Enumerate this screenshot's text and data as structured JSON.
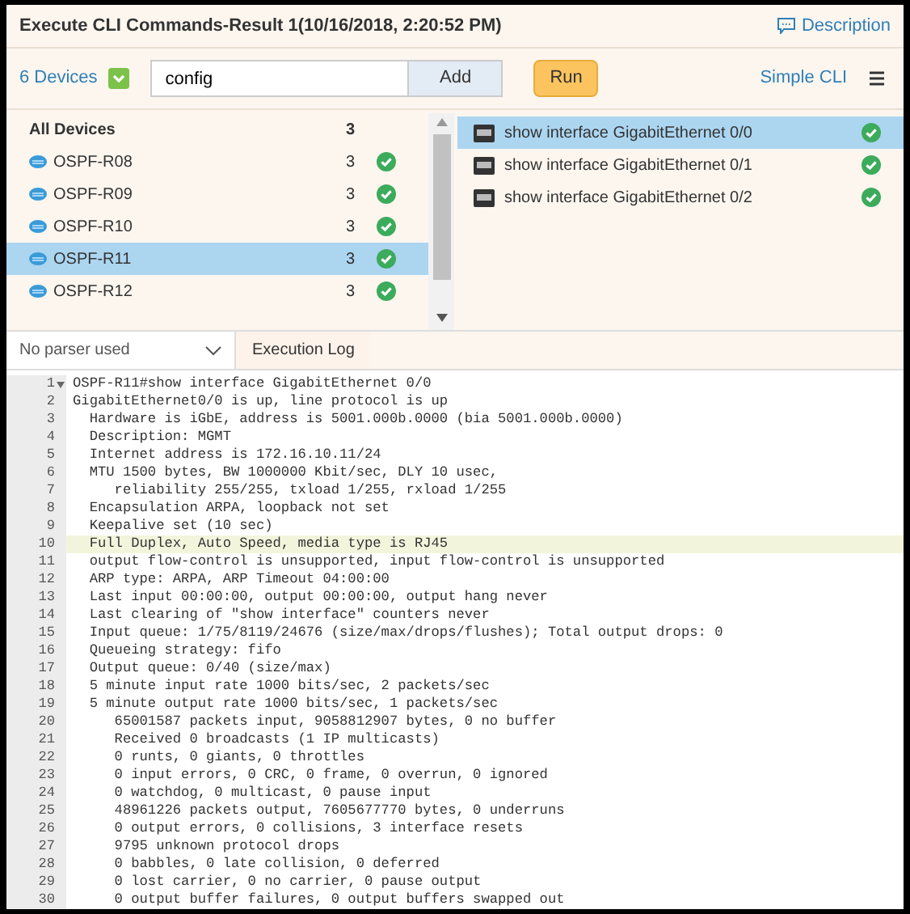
{
  "window": {
    "title": "Execute CLI Commands-Result 1(10/16/2018, 2:20:52 PM)",
    "description_link": "Description"
  },
  "toolbar": {
    "devices_link": "6 Devices",
    "command_input": {
      "value": "config"
    },
    "add_button": "Add",
    "run_button": "Run",
    "mode_link": "Simple CLI"
  },
  "devices": {
    "header": {
      "name": "All Devices",
      "count": "3"
    },
    "rows": [
      {
        "name": "OSPF-R08",
        "count": "3",
        "selected": false
      },
      {
        "name": "OSPF-R09",
        "count": "3",
        "selected": false
      },
      {
        "name": "OSPF-R10",
        "count": "3",
        "selected": false
      },
      {
        "name": "OSPF-R11",
        "count": "3",
        "selected": true
      },
      {
        "name": "OSPF-R12",
        "count": "3",
        "selected": false
      }
    ]
  },
  "commands": [
    {
      "text": "show interface GigabitEthernet 0/0",
      "selected": true
    },
    {
      "text": "show interface GigabitEthernet 0/1",
      "selected": false
    },
    {
      "text": "show interface GigabitEthernet 0/2",
      "selected": false
    }
  ],
  "parser_select": {
    "value": "No parser used"
  },
  "log_tab": "Execution Log",
  "output": [
    {
      "n": "1",
      "text": "OSPF-R11#show interface GigabitEthernet 0/0",
      "selected": false
    },
    {
      "n": "2",
      "text": "GigabitEthernet0/0 is up, line protocol is up",
      "selected": false
    },
    {
      "n": "3",
      "text": "  Hardware is iGbE, address is 5001.000b.0000 (bia 5001.000b.0000)",
      "selected": false
    },
    {
      "n": "4",
      "text": "  Description: MGMT",
      "selected": false
    },
    {
      "n": "5",
      "text": "  Internet address is 172.16.10.11/24",
      "selected": false
    },
    {
      "n": "6",
      "text": "  MTU 1500 bytes, BW 1000000 Kbit/sec, DLY 10 usec,",
      "selected": false
    },
    {
      "n": "7",
      "text": "     reliability 255/255, txload 1/255, rxload 1/255",
      "selected": false
    },
    {
      "n": "8",
      "text": "  Encapsulation ARPA, loopback not set",
      "selected": false
    },
    {
      "n": "9",
      "text": "  Keepalive set (10 sec)",
      "selected": false
    },
    {
      "n": "10",
      "text": "  Full Duplex, Auto Speed, media type is RJ45",
      "selected": true
    },
    {
      "n": "11",
      "text": "  output flow-control is unsupported, input flow-control is unsupported",
      "selected": false
    },
    {
      "n": "12",
      "text": "  ARP type: ARPA, ARP Timeout 04:00:00",
      "selected": false
    },
    {
      "n": "13",
      "text": "  Last input 00:00:00, output 00:00:00, output hang never",
      "selected": false
    },
    {
      "n": "14",
      "text": "  Last clearing of \"show interface\" counters never",
      "selected": false
    },
    {
      "n": "15",
      "text": "  Input queue: 1/75/8119/24676 (size/max/drops/flushes); Total output drops: 0",
      "selected": false
    },
    {
      "n": "16",
      "text": "  Queueing strategy: fifo",
      "selected": false
    },
    {
      "n": "17",
      "text": "  Output queue: 0/40 (size/max)",
      "selected": false
    },
    {
      "n": "18",
      "text": "  5 minute input rate 1000 bits/sec, 2 packets/sec",
      "selected": false
    },
    {
      "n": "19",
      "text": "  5 minute output rate 1000 bits/sec, 1 packets/sec",
      "selected": false
    },
    {
      "n": "20",
      "text": "     65001587 packets input, 9058812907 bytes, 0 no buffer",
      "selected": false
    },
    {
      "n": "21",
      "text": "     Received 0 broadcasts (1 IP multicasts)",
      "selected": false
    },
    {
      "n": "22",
      "text": "     0 runts, 0 giants, 0 throttles",
      "selected": false
    },
    {
      "n": "23",
      "text": "     0 input errors, 0 CRC, 0 frame, 0 overrun, 0 ignored",
      "selected": false
    },
    {
      "n": "24",
      "text": "     0 watchdog, 0 multicast, 0 pause input",
      "selected": false
    },
    {
      "n": "25",
      "text": "     48961226 packets output, 7605677770 bytes, 0 underruns",
      "selected": false
    },
    {
      "n": "26",
      "text": "     0 output errors, 0 collisions, 3 interface resets",
      "selected": false
    },
    {
      "n": "27",
      "text": "     9795 unknown protocol drops",
      "selected": false
    },
    {
      "n": "28",
      "text": "     0 babbles, 0 late collision, 0 deferred",
      "selected": false
    },
    {
      "n": "29",
      "text": "     0 lost carrier, 0 no carrier, 0 pause output",
      "selected": false
    },
    {
      "n": "30",
      "text": "     0 output buffer failures, 0 output buffers swapped out",
      "selected": false
    }
  ]
}
